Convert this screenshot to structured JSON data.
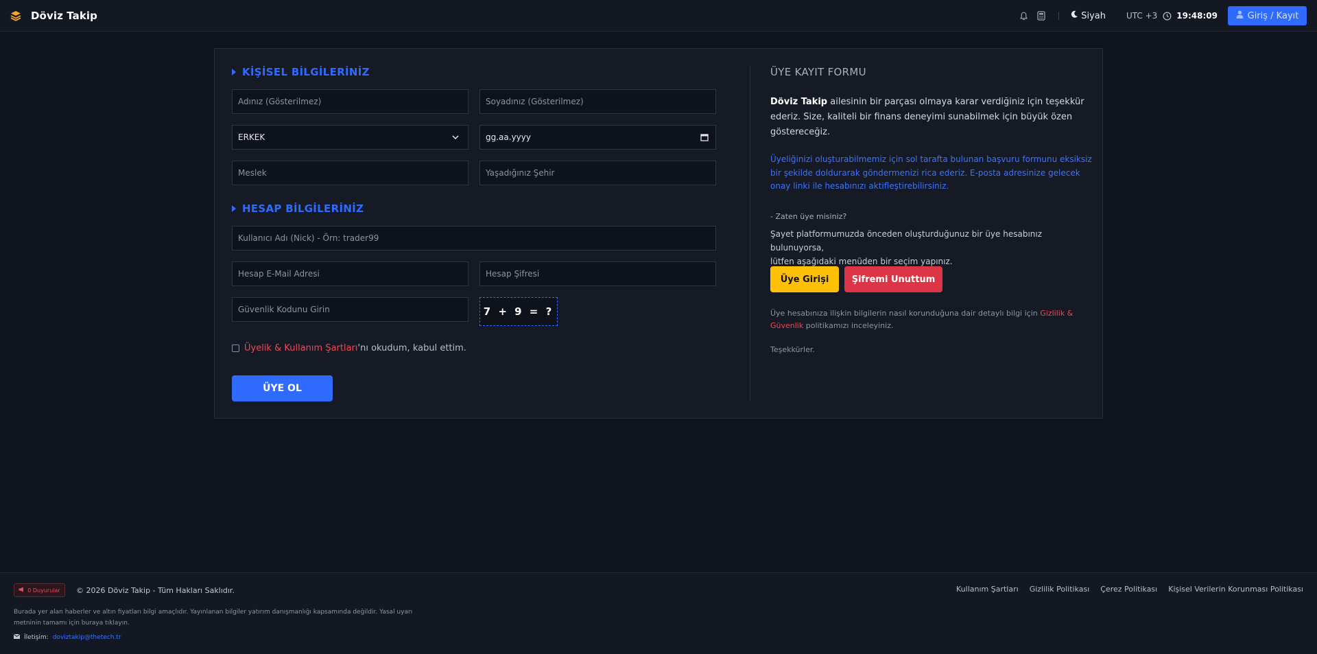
{
  "header": {
    "brand": "Döviz Takip",
    "theme_label": "Siyah",
    "utc_label": "UTC +3",
    "time": "19:48:09",
    "login_label": "Giriş / Kayıt",
    "icons": [
      "layers-icon",
      "bell-icon",
      "calculator-icon",
      "moon-icon",
      "clock-icon",
      "user-icon"
    ]
  },
  "form": {
    "personal_title": "KİŞİSEL BİLGİLERİNİZ",
    "first_name_placeholder": "Adınız (Gösterilmez)",
    "last_name_placeholder": "Soyadınız (Gösterilmez)",
    "gender_value": "ERKEK",
    "birthdate_placeholder": "gg.aa.yyyy",
    "job_placeholder": "Meslek",
    "city_placeholder": "Yaşadığınız Şehir",
    "account_title": "HESAP BİLGİLERİNİZ",
    "username_placeholder": "Kullanıcı Adı (Nick) - Örn: trader99",
    "email_placeholder": "Hesap E-Mail Adresi",
    "password_placeholder": "Hesap Şifresi",
    "captcha_placeholder": "Güvenlik Kodunu Girin",
    "captcha_text": "7 + 9 = ?",
    "terms_link": "Üyelik & Kullanım Şartları",
    "terms_rest": "'nı okudum, kabul ettim.",
    "submit_label": "ÜYE OL"
  },
  "info": {
    "title": "ÜYE KAYIT FORMU",
    "intro_bold": "Döviz Takip",
    "intro_line1": " ailesinin bir parçası olmaya karar verdiğiniz için teşekkür",
    "intro_line2": "ederiz. Size, kaliteli bir finans deneyimi sunabilmek için büyük özen",
    "intro_line3": "göstereceğiz.",
    "blue_line1": "Üyeliğinizi oluşturabilmemiz için sol tarafta bulunan başvuru formunu eksiksiz",
    "blue_line2": "bir şekilde doldurarak göndermenizi rica ederiz. E-posta adresinize gelecek",
    "blue_line3": "onay linki ile hesabınızı aktifleştirebilirsiniz.",
    "already_member": "- Zaten üye misiniz?",
    "existing_line1": "Şayet platformumuzda önceden oluşturduğunuz bir üye hesabınız bulunuyorsa,",
    "existing_line2": "lütfen aşağıdaki menüden bir seçim yapınız.",
    "login_button": "Üye Girişi",
    "forgot_button": "Şifremi Unuttum",
    "privacy_pre": "Üye hesabınıza ilişkin bilgilerin nasıl korunduğuna dair detaylı bilgi için ",
    "privacy_link1": "Gizlilik &",
    "privacy_link2": "Güvenlik",
    "privacy_post": " politikamızı inceleyiniz.",
    "thanks": "Teşekkürler."
  },
  "footer": {
    "announcements": "0 Duyurular",
    "copyright": "© 2026 Döviz Takip - Tüm Hakları Saklıdır.",
    "disclaimer_line1": "Burada yer alan haberler ve altın fiyatları bilgi amaçlıdır. Yayınlanan bilgiler yatırım danışmanlığı kapsamında değildir. Yasal uyarı",
    "disclaimer_line2": "metninin tamamı için buraya tıklayın.",
    "contact_label": "İletişim:",
    "contact_email": "doviztakip@thetech.tr",
    "links": [
      "Kullanım Şartları",
      "Gizlilik Politikası",
      "Çerez Politikası",
      "Kişisel Verilerin Korunması Politikası"
    ]
  },
  "colors": {
    "background": "#0f131b",
    "accent": "#2f6bff",
    "danger": "#dc3545",
    "warning": "#ffc107"
  }
}
